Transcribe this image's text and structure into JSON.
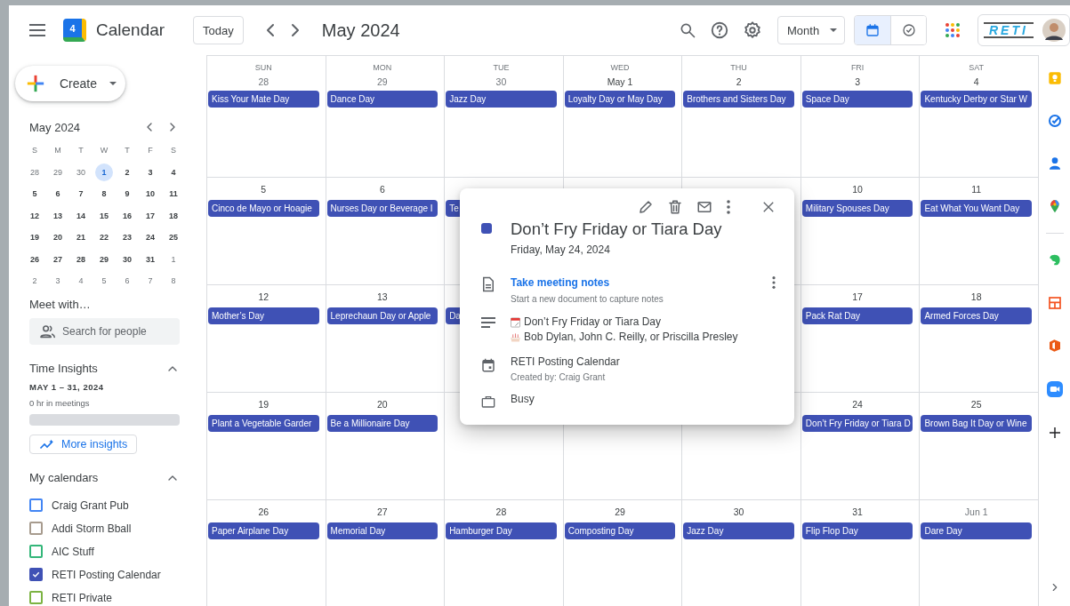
{
  "header": {
    "logo_day": "4",
    "app_name": "Calendar",
    "today_button": "Today",
    "title": "May 2024",
    "view_select": "Month",
    "view_toggle": [
      {
        "kind": "calendar",
        "selected": true
      },
      {
        "kind": "tasks",
        "selected": false
      }
    ],
    "account_logo": "RETI"
  },
  "sidebar": {
    "create_button": "Create",
    "mini_title": "May 2024",
    "mini_weekdays": [
      "S",
      "M",
      "T",
      "W",
      "T",
      "F",
      "S"
    ],
    "mini_weeks": [
      [
        {
          "day": "28",
          "muted": true,
          "selected": false
        },
        {
          "day": "29",
          "muted": true,
          "selected": false
        },
        {
          "day": "30",
          "muted": true,
          "selected": false
        },
        {
          "day": "1",
          "muted": false,
          "selected": true
        },
        {
          "day": "2",
          "muted": false,
          "selected": false
        },
        {
          "day": "3",
          "muted": false,
          "selected": false
        },
        {
          "day": "4",
          "muted": false,
          "selected": false
        }
      ],
      [
        {
          "day": "5",
          "muted": false,
          "selected": false
        },
        {
          "day": "6",
          "muted": false,
          "selected": false
        },
        {
          "day": "7",
          "muted": false,
          "selected": false
        },
        {
          "day": "8",
          "muted": false,
          "selected": false
        },
        {
          "day": "9",
          "muted": false,
          "selected": false
        },
        {
          "day": "10",
          "muted": false,
          "selected": false
        },
        {
          "day": "11",
          "muted": false,
          "selected": false
        }
      ],
      [
        {
          "day": "12",
          "muted": false,
          "selected": false
        },
        {
          "day": "13",
          "muted": false,
          "selected": false
        },
        {
          "day": "14",
          "muted": false,
          "selected": false
        },
        {
          "day": "15",
          "muted": false,
          "selected": false
        },
        {
          "day": "16",
          "muted": false,
          "selected": false
        },
        {
          "day": "17",
          "muted": false,
          "selected": false
        },
        {
          "day": "18",
          "muted": false,
          "selected": false
        }
      ],
      [
        {
          "day": "19",
          "muted": false,
          "selected": false
        },
        {
          "day": "20",
          "muted": false,
          "selected": false
        },
        {
          "day": "21",
          "muted": false,
          "selected": false
        },
        {
          "day": "22",
          "muted": false,
          "selected": false
        },
        {
          "day": "23",
          "muted": false,
          "selected": false
        },
        {
          "day": "24",
          "muted": false,
          "selected": false
        },
        {
          "day": "25",
          "muted": false,
          "selected": false
        }
      ],
      [
        {
          "day": "26",
          "muted": false,
          "selected": false
        },
        {
          "day": "27",
          "muted": false,
          "selected": false
        },
        {
          "day": "28",
          "muted": false,
          "selected": false
        },
        {
          "day": "29",
          "muted": false,
          "selected": false
        },
        {
          "day": "30",
          "muted": false,
          "selected": false
        },
        {
          "day": "31",
          "muted": false,
          "selected": false
        },
        {
          "day": "1",
          "muted": true,
          "selected": false
        }
      ],
      [
        {
          "day": "2",
          "muted": true,
          "selected": false
        },
        {
          "day": "3",
          "muted": true,
          "selected": false
        },
        {
          "day": "4",
          "muted": true,
          "selected": false
        },
        {
          "day": "5",
          "muted": true,
          "selected": false
        },
        {
          "day": "6",
          "muted": true,
          "selected": false
        },
        {
          "day": "7",
          "muted": true,
          "selected": false
        },
        {
          "day": "8",
          "muted": true,
          "selected": false
        }
      ]
    ],
    "meet_title": "Meet with…",
    "people_search": {
      "placeholder": "Search for people"
    },
    "insights_title": "Time Insights",
    "insights_range": "MAY 1 – 31, 2024",
    "insights_summary": "0 hr in meetings",
    "insights_button": "More insights",
    "calendars_title": "My calendars",
    "calendars": [
      {
        "name": "Craig Grant Pub",
        "color": "#4285f4",
        "checked": false
      },
      {
        "name": "Addi Storm Bball",
        "color": "#a79b8e",
        "checked": false
      },
      {
        "name": "AIC Stuff",
        "color": "#33b679",
        "checked": false
      },
      {
        "name": "RETI Posting Calendar",
        "color": "#3f51b5",
        "checked": true
      },
      {
        "name": "RETI Private",
        "color": "#7cb342",
        "checked": false
      }
    ]
  },
  "month": {
    "weekdays": [
      "SUN",
      "MON",
      "TUE",
      "WED",
      "THU",
      "FRI",
      "SAT"
    ],
    "weeks": [
      {
        "sun": {
          "date": "28",
          "muted": true,
          "events": [
            "Kiss Your Mate Day"
          ]
        },
        "mon": {
          "date": "29",
          "muted": true,
          "events": [
            "Dance Day"
          ]
        },
        "tue": {
          "date": "30",
          "muted": true,
          "events": [
            "Jazz Day"
          ]
        },
        "wed": {
          "date": "May 1",
          "muted": false,
          "events": [
            "Loyalty Day or May Day"
          ]
        },
        "thu": {
          "date": "2",
          "muted": false,
          "events": [
            "Brothers and Sisters Day"
          ]
        },
        "fri": {
          "date": "3",
          "muted": false,
          "events": [
            "Space Day"
          ]
        },
        "sat": {
          "date": "4",
          "muted": false,
          "events": [
            "Kentucky Derby or Star W"
          ]
        }
      },
      {
        "sun": {
          "date": "5",
          "muted": false,
          "events": [
            "Cinco de Mayo or Hoagie"
          ]
        },
        "mon": {
          "date": "6",
          "muted": false,
          "events": [
            "Nurses Day or Beverage I"
          ]
        },
        "tue": {
          "events": [
            "Te"
          ]
        },
        "fri": {
          "date": "10",
          "muted": false,
          "events": [
            "Military Spouses Day"
          ]
        },
        "sat": {
          "date": "11",
          "muted": false,
          "events": [
            "Eat What You Want Day"
          ]
        }
      },
      {
        "sun": {
          "date": "12",
          "muted": false,
          "events": [
            "Mother’s Day"
          ]
        },
        "mon": {
          "date": "13",
          "muted": false,
          "events": [
            "Leprechaun Day or Apple"
          ]
        },
        "tue": {
          "events": [
            "Da"
          ]
        },
        "fri": {
          "date": "17",
          "muted": false,
          "events": [
            "Pack Rat Day"
          ]
        },
        "sat": {
          "date": "18",
          "muted": false,
          "events": [
            "Armed Forces Day"
          ]
        }
      },
      {
        "sun": {
          "date": "19",
          "muted": false,
          "events": [
            "Plant a Vegetable Garder"
          ]
        },
        "mon": {
          "date": "20",
          "muted": false,
          "events": [
            "Be a Millionaire Day"
          ]
        },
        "fri": {
          "date": "24",
          "muted": false,
          "events": [
            "Don’t Fry Friday or Tiara D"
          ]
        },
        "sat": {
          "date": "25",
          "muted": false,
          "events": [
            "Brown Bag It Day or Wine"
          ]
        }
      },
      {
        "sun": {
          "date": "26",
          "muted": false,
          "events": [
            "Paper Airplane Day"
          ]
        },
        "mon": {
          "date": "27",
          "muted": false,
          "events": [
            "Memorial Day"
          ]
        },
        "tue": {
          "date": "28",
          "muted": false,
          "events": [
            "Hamburger Day"
          ]
        },
        "wed": {
          "date": "29",
          "muted": false,
          "events": [
            "Composting Day"
          ]
        },
        "thu": {
          "date": "30",
          "muted": false,
          "events": [
            "Jazz Day"
          ]
        },
        "fri": {
          "date": "31",
          "muted": false,
          "events": [
            "Flip Flop Day"
          ]
        },
        "sat": {
          "date": "Jun 1",
          "muted": true,
          "events": [
            "Dare Day"
          ]
        }
      }
    ]
  },
  "popup": {
    "title": "Don’t Fry Friday or Tiara Day",
    "color": "#3f51b5",
    "date": "Friday, May 24, 2024",
    "notes_link": "Take meeting notes",
    "notes_hint": "Start a new document to capture notes",
    "description": [
      {
        "kind": "calendar",
        "text": "Don’t Fry Friday or Tiara Day"
      },
      {
        "kind": "cake",
        "text": "Bob Dylan, John C. Reilly, or Priscilla Presley"
      }
    ],
    "calendar": "RETI Posting Calendar",
    "created_by": "Created by: Craig Grant",
    "availability": "Busy"
  }
}
